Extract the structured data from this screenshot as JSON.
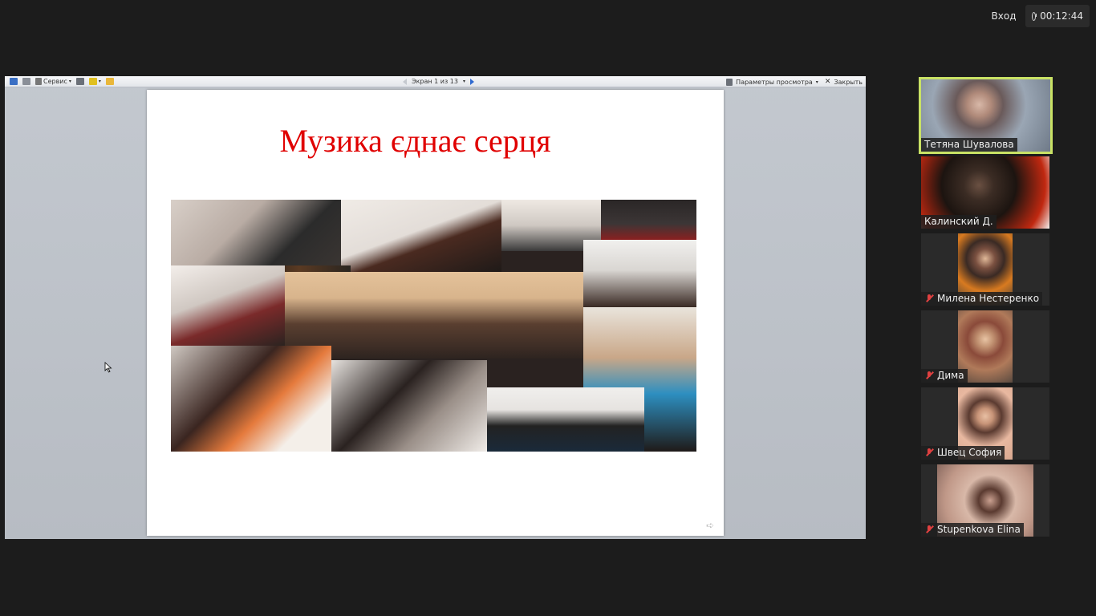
{
  "topbar": {
    "login_label": "Вход",
    "timer": "00:12:44"
  },
  "viewer_toolbar": {
    "service_label": "Сервис",
    "screen_counter": "Экран 1 из 13",
    "view_params_label": "Параметры просмотра",
    "close_label": "Закрыть"
  },
  "slide": {
    "title": "Музика єднає серця"
  },
  "participants": [
    {
      "name": "Тетяна Шувалова",
      "muted": false,
      "active": true
    },
    {
      "name": "Калинский Д.",
      "muted": false,
      "active": false
    },
    {
      "name": "Милена Нестеренко",
      "muted": true,
      "active": false
    },
    {
      "name": "Дима",
      "muted": true,
      "active": false
    },
    {
      "name": "Швец София",
      "muted": true,
      "active": false
    },
    {
      "name": "Stupenkova Elina",
      "muted": true,
      "active": false
    }
  ],
  "colors": {
    "title_red": "#e00000",
    "active_speaker_border": "#c9e265",
    "muted_mic": "#e04040"
  }
}
